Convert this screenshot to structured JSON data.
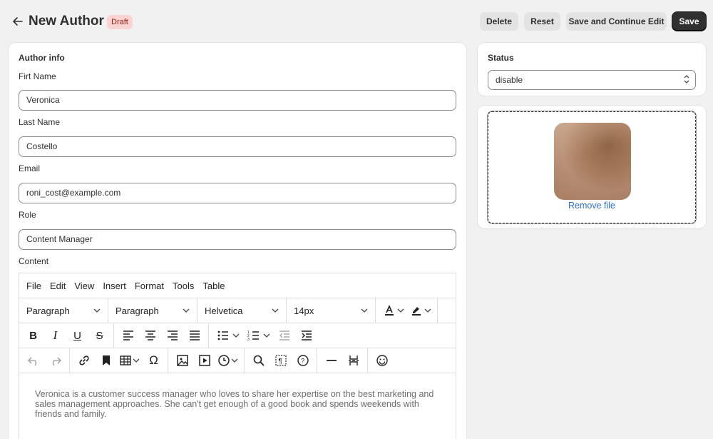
{
  "header": {
    "title": "New Author",
    "badge": "Draft",
    "buttons": {
      "delete": "Delete",
      "reset": "Reset",
      "save_continue": "Save and Continue Edit",
      "save": "Save"
    }
  },
  "author_info": {
    "heading": "Author info",
    "first_name": {
      "label": "Firt Name",
      "value": "Veronica"
    },
    "last_name": {
      "label": "Last Name",
      "value": "Costello"
    },
    "email": {
      "label": "Email",
      "value": "roni_cost@example.com"
    },
    "role": {
      "label": "Role",
      "value": "Content Manager"
    },
    "content_label": "Content"
  },
  "editor": {
    "menu": [
      "File",
      "Edit",
      "View",
      "Insert",
      "Format",
      "Tools",
      "Table"
    ],
    "selects": {
      "block1": "Paragraph",
      "block2": "Paragraph",
      "font": "Helvetica",
      "size": "14px"
    },
    "text": "Veronica is a customer success manager who loves to share her expertise on the best marketing and sales management approaches. She can't get enough of a good book and spends weekends with friends and family."
  },
  "status": {
    "heading": "Status",
    "value": "disable"
  },
  "upload": {
    "remove_label": "Remove file"
  }
}
